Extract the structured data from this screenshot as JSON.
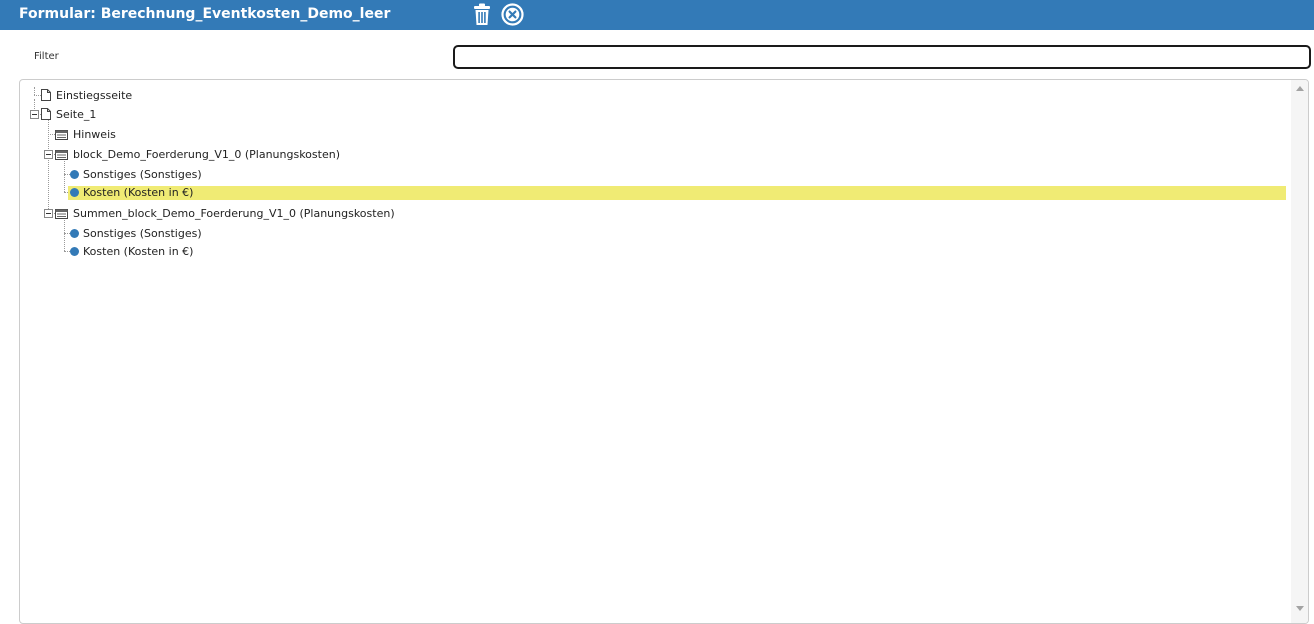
{
  "header": {
    "title": "Formular: Berechnung_Eventkosten_Demo_leer",
    "delete_icon": "trash-icon",
    "close_icon": "close-circle-icon",
    "background_color": "#337ab7"
  },
  "filter": {
    "label": "Filter",
    "value": ""
  },
  "tree": {
    "highlight_color": "#f0eb74",
    "nodes": [
      {
        "label": "Einstiegsseite",
        "icon": "page-icon"
      },
      {
        "label": "Seite_1",
        "icon": "page-icon",
        "expanded": true
      },
      {
        "label": "Hinweis",
        "icon": "block-icon"
      },
      {
        "label": "block_Demo_Foerderung_V1_0 (Planungskosten)",
        "icon": "block-icon",
        "expanded": true
      },
      {
        "label": "Sonstiges (Sonstiges)",
        "icon": "field-dot-icon"
      },
      {
        "label": "Kosten (Kosten in €)",
        "icon": "field-dot-icon",
        "selected": true
      },
      {
        "label": "Summen_block_Demo_Foerderung_V1_0 (Planungskosten)",
        "icon": "block-icon",
        "expanded": true
      },
      {
        "label": "Sonstiges (Sonstiges)",
        "icon": "field-dot-icon"
      },
      {
        "label": "Kosten (Kosten in €)",
        "icon": "field-dot-icon"
      }
    ]
  }
}
